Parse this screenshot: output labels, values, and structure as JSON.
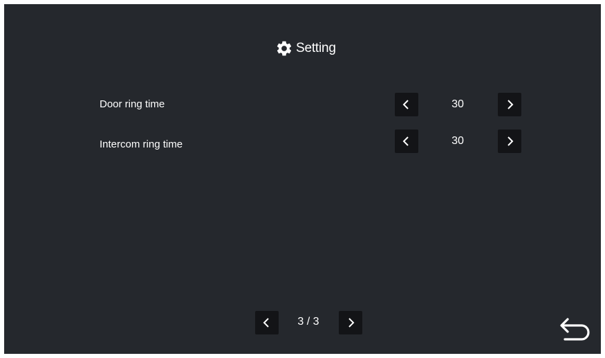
{
  "header": {
    "title": "Setting",
    "icon": "gear-icon"
  },
  "settings": [
    {
      "label": "Door ring time",
      "value": "30"
    },
    {
      "label": "Intercom ring time",
      "value": "30"
    }
  ],
  "pagination": {
    "indicator": "3 / 3"
  },
  "icons": {
    "decrease": "chevron-left-icon",
    "increase": "chevron-right-icon",
    "back": "return-arrow-icon"
  },
  "colors": {
    "background": "#25282d",
    "button": "#131417",
    "text": "#ffffff"
  }
}
